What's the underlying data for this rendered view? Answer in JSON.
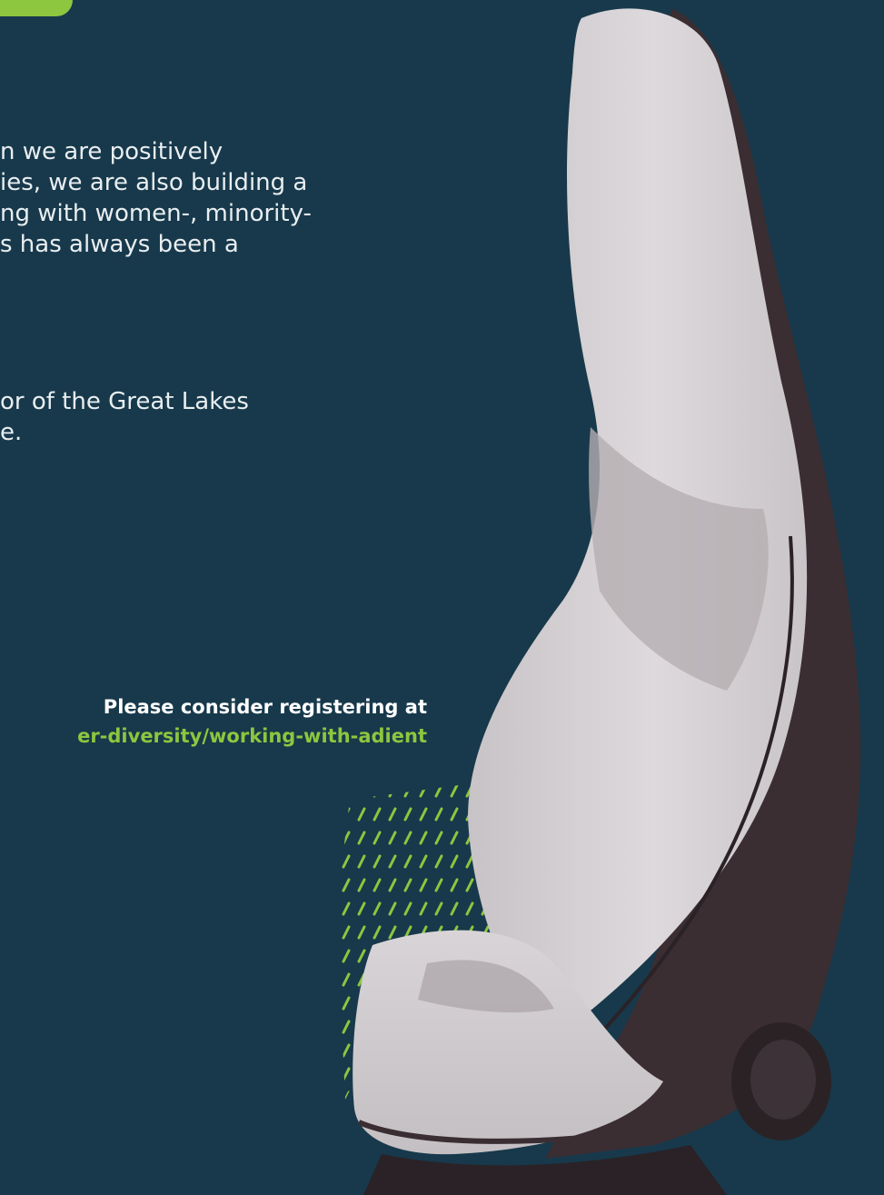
{
  "body": {
    "paragraph_1": [
      "n we are positively",
      "ies, we are also building a",
      "ng with women-, minority-",
      "s has always been a"
    ],
    "paragraph_2": [
      "or of the Great Lakes",
      "e."
    ]
  },
  "callout": {
    "line_1": "Please consider registering at",
    "link_text": "er-diversity/working-with-adient"
  },
  "colors": {
    "background": "#17394b",
    "accent": "#8dc63f",
    "body_text": "#e9eef1"
  },
  "image": {
    "subject": "vehicle seat"
  }
}
